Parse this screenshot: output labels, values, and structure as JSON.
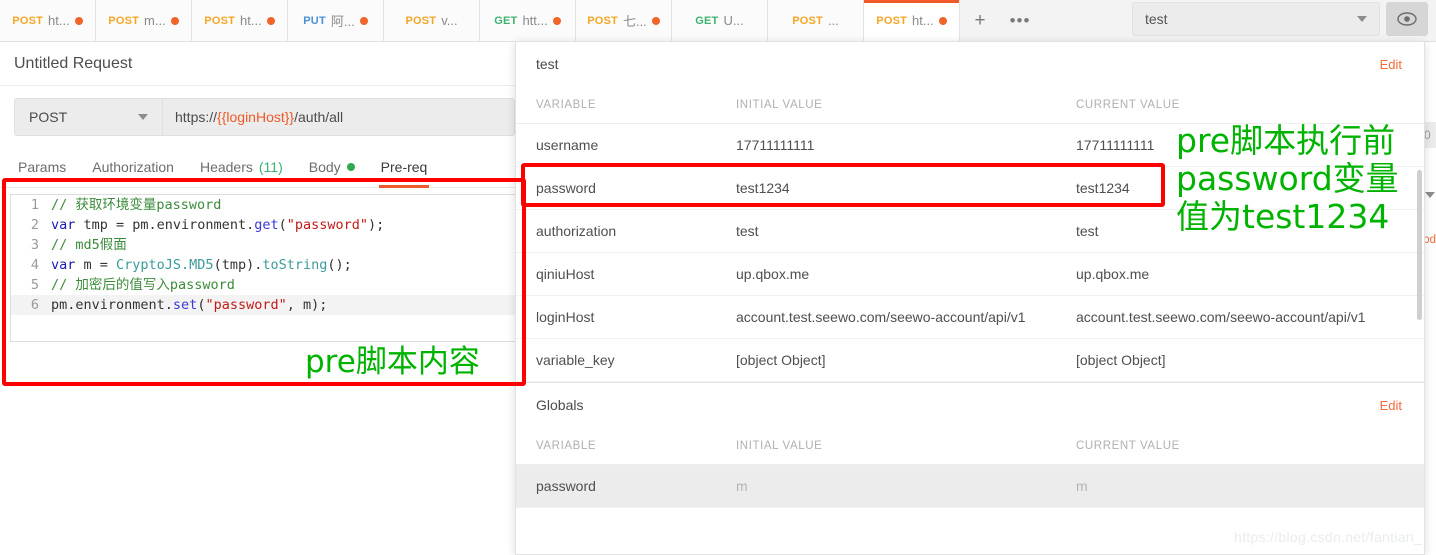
{
  "request_tabs": [
    {
      "method": "POST",
      "name": "ht...",
      "unsaved": true,
      "active": false
    },
    {
      "method": "POST",
      "name": "m...",
      "unsaved": true,
      "active": false
    },
    {
      "method": "POST",
      "name": "ht...",
      "unsaved": true,
      "active": false
    },
    {
      "method": "PUT",
      "name": "阿...",
      "unsaved": true,
      "active": false
    },
    {
      "method": "POST",
      "name": "v...",
      "unsaved": false,
      "active": false
    },
    {
      "method": "GET",
      "name": "htt...",
      "unsaved": true,
      "active": false
    },
    {
      "method": "POST",
      "name": "七...",
      "unsaved": true,
      "active": false
    },
    {
      "method": "GET",
      "name": "U...",
      "unsaved": false,
      "active": false
    },
    {
      "method": "POST",
      "name": "...",
      "unsaved": false,
      "active": false
    },
    {
      "method": "POST",
      "name": "ht...",
      "unsaved": true,
      "active": true
    }
  ],
  "tabbar": {
    "add_label": "+",
    "more_label": "•••",
    "add_icon": "plus-icon",
    "more_icon": "ellipsis-icon"
  },
  "env_selector": {
    "value": "test",
    "caret_icon": "chevron-down-icon",
    "eye_icon": "eye-icon"
  },
  "request": {
    "title": "Untitled Request",
    "method": "POST",
    "method_caret_icon": "chevron-down-icon",
    "url_prefix": "https://",
    "url_variable": "{{loginHost}}",
    "url_suffix": "/auth/all",
    "tabs": [
      {
        "label": "Params",
        "active": false
      },
      {
        "label": "Authorization",
        "active": false
      },
      {
        "label": "Headers",
        "count": "(11)",
        "active": false
      },
      {
        "label": "Body",
        "dot": true,
        "active": false
      },
      {
        "label": "Pre-req",
        "active": true
      }
    ]
  },
  "code": {
    "lines": [
      {
        "n": "1",
        "segments": [
          {
            "t": "// 获取环境变量password",
            "c": "c-com"
          }
        ]
      },
      {
        "n": "2",
        "segments": [
          {
            "t": "var ",
            "c": "c-kw"
          },
          {
            "t": "tmp = pm.environment.",
            "c": "c-pl"
          },
          {
            "t": "get",
            "c": "c-fn"
          },
          {
            "t": "(",
            "c": "c-pl"
          },
          {
            "t": "\"password\"",
            "c": "c-str"
          },
          {
            "t": ");",
            "c": "c-pl"
          }
        ]
      },
      {
        "n": "3",
        "segments": [
          {
            "t": "// md5假面",
            "c": "c-com"
          }
        ]
      },
      {
        "n": "4",
        "segments": [
          {
            "t": "var ",
            "c": "c-kw"
          },
          {
            "t": "m = ",
            "c": "c-pl"
          },
          {
            "t": "CryptoJS.MD5",
            "c": "c-cls"
          },
          {
            "t": "(tmp).",
            "c": "c-pl"
          },
          {
            "t": "toString",
            "c": "c-cls"
          },
          {
            "t": "();",
            "c": "c-pl"
          }
        ]
      },
      {
        "n": "5",
        "segments": [
          {
            "t": "// 加密后的值写入password",
            "c": "c-com"
          }
        ]
      },
      {
        "n": "6",
        "segments": [
          {
            "t": "pm.environment.",
            "c": "c-pl"
          },
          {
            "t": "set",
            "c": "c-fn"
          },
          {
            "t": "(",
            "c": "c-pl"
          },
          {
            "t": "\"password\"",
            "c": "c-str"
          },
          {
            "t": ", m);",
            "c": "c-pl"
          }
        ]
      }
    ]
  },
  "annotations": {
    "script_note": "pre脚本内容",
    "env_note": "pre脚本执行前\npassword变量\n值为test1234"
  },
  "env_panel": {
    "environment": {
      "name": "test",
      "edit_label": "Edit",
      "headers": {
        "variable": "VARIABLE",
        "initial": "INITIAL VALUE",
        "current": "CURRENT VALUE"
      },
      "rows": [
        {
          "variable": "username",
          "initial": "17711111111",
          "current": "17711111111"
        },
        {
          "variable": "password",
          "initial": "test1234",
          "current": "test1234"
        },
        {
          "variable": "authorization",
          "initial": "test",
          "current": "test"
        },
        {
          "variable": "qiniuHost",
          "initial": "up.qbox.me",
          "current": "up.qbox.me"
        },
        {
          "variable": "loginHost",
          "initial": "account.test.seewo.com/seewo-account/api/v1",
          "current": "account.test.seewo.com/seewo-account/api/v1"
        },
        {
          "variable": "variable_key",
          "initial": "[object Object]",
          "current": "[object Object]"
        }
      ]
    },
    "globals": {
      "name": "Globals",
      "edit_label": "Edit",
      "headers": {
        "variable": "VARIABLE",
        "initial": "INITIAL VALUE",
        "current": "CURRENT VALUE"
      },
      "rows": [
        {
          "variable": "password",
          "initial": "m",
          "current": "m"
        }
      ]
    }
  },
  "right_peek": {
    "save_fragment": "0",
    "code_fragment": "Cod",
    "caret_icon": "chevron-down-icon"
  },
  "watermark": "https://blog.csdn.net/fantian_",
  "colors": {
    "accent_orange": "#f05a28",
    "edit_orange": "#f26b3a",
    "method_post": "#f5a623",
    "method_get": "#3cb371",
    "method_put": "#4a90d9",
    "annotation_red": "#ff0000",
    "annotation_green": "#00b300"
  }
}
